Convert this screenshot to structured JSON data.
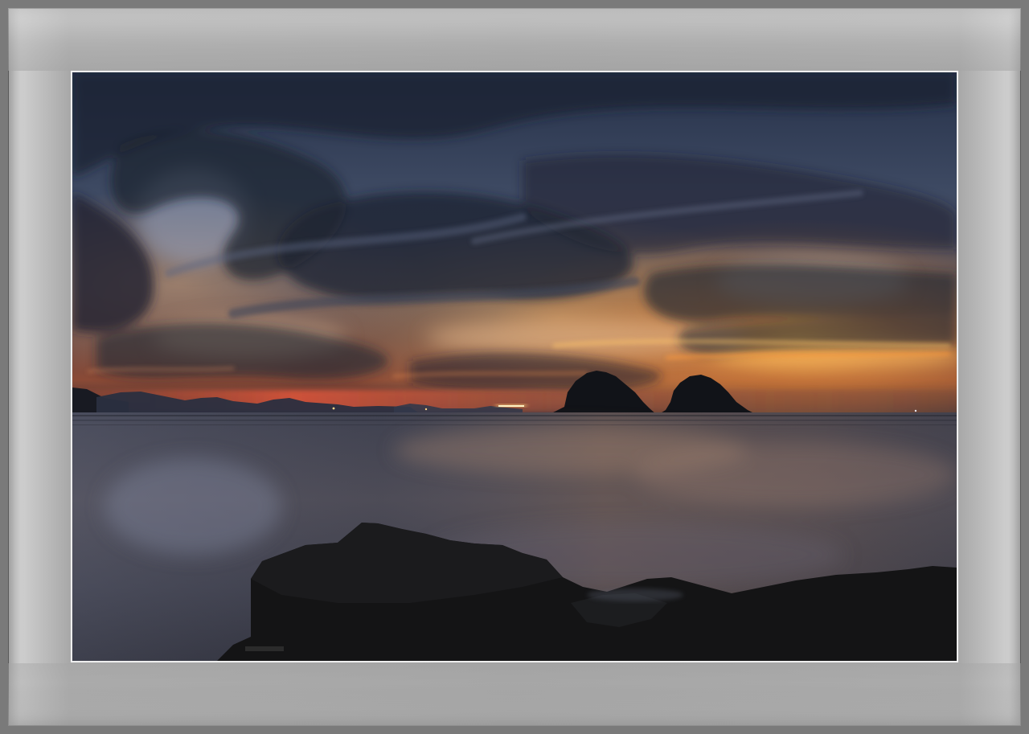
{
  "photo": {
    "subject": "sunset-seascape",
    "colors": {
      "sky_top": "#2c3a52",
      "sky_mid": "#4a5266",
      "glow_orange": "#f2a23a",
      "glow_red": "#d9542e",
      "water": "#3a3c48",
      "rock": "#151617",
      "mat": "#a6a6a6"
    }
  }
}
